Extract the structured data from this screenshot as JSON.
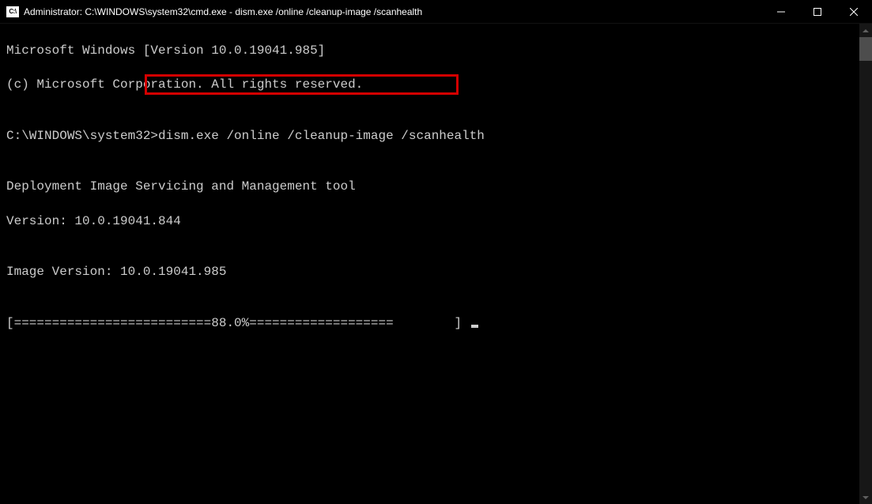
{
  "titlebar": {
    "icon_label": "C:\\",
    "title": "Administrator: C:\\WINDOWS\\system32\\cmd.exe - dism.exe  /online /cleanup-image /scanhealth"
  },
  "terminal": {
    "line1": "Microsoft Windows [Version 10.0.19041.985]",
    "line2": "(c) Microsoft Corporation. All rights reserved.",
    "prompt": "C:\\WINDOWS\\system32>",
    "command": "dism.exe /online /cleanup-image /scanhealth",
    "tool_line1": "Deployment Image Servicing and Management tool",
    "tool_line2": "Version: 10.0.19041.844",
    "image_version": "Image Version: 10.0.19041.985",
    "progress": "[==========================88.0%===================        ] "
  }
}
